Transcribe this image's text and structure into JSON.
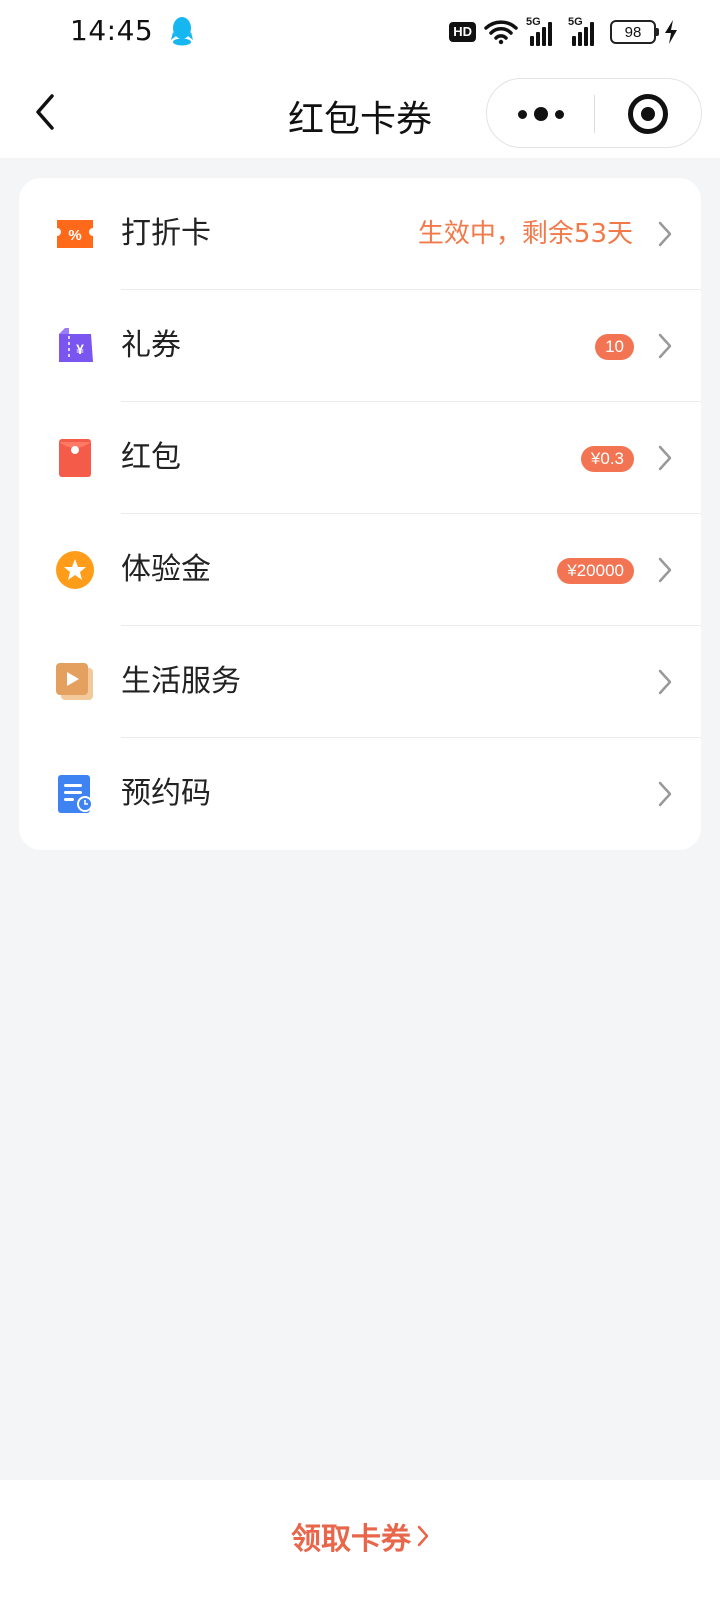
{
  "status_bar": {
    "time": "14:45",
    "network_badge": "HD",
    "signal_1": "5G",
    "signal_2": "5G",
    "battery": "98"
  },
  "nav": {
    "title": "红包卡券"
  },
  "items": [
    {
      "label": "打折卡",
      "status": "生效中，剩余53天",
      "icon": "discount-card-icon",
      "color": "#ff6a1a"
    },
    {
      "label": "礼券",
      "badge": "10",
      "icon": "gift-voucher-icon",
      "color": "#7a55f0"
    },
    {
      "label": "红包",
      "badge": "¥0.3",
      "icon": "red-packet-icon",
      "color": "#f45b48"
    },
    {
      "label": "体验金",
      "badge": "¥20000",
      "icon": "trial-gold-star-icon",
      "color": "#ff9d1a"
    },
    {
      "label": "生活服务",
      "icon": "life-service-play-icon",
      "color": "#e3a05e"
    },
    {
      "label": "预约码",
      "icon": "appointment-code-icon",
      "color": "#3f82f2"
    }
  ],
  "bottom": {
    "link_label": "领取卡券"
  },
  "colors": {
    "accent": "#f27452",
    "status_text": "#f27a4a",
    "background": "#f4f5f7"
  }
}
